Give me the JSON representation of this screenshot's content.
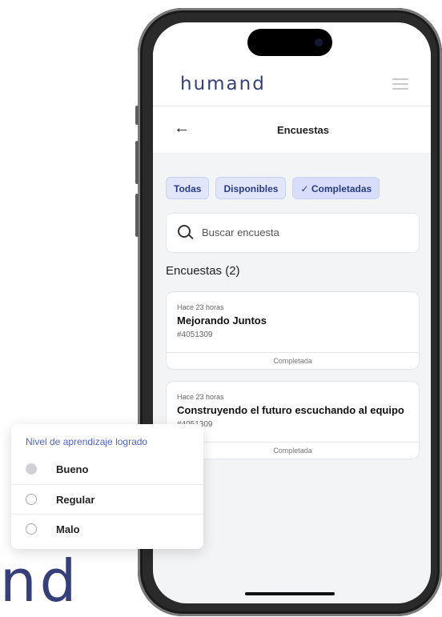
{
  "brand": "humand",
  "navbar": {
    "title": "Encuestas"
  },
  "chips": [
    {
      "label": "Todas"
    },
    {
      "label": "Disponibles"
    },
    {
      "label": "✓ Completadas"
    }
  ],
  "search": {
    "placeholder": "Buscar encuesta"
  },
  "section_title": "Encuestas (2)",
  "surveys": [
    {
      "time": "Hace 23 horas",
      "title": "Mejorando Juntos",
      "id": "#4051309",
      "status": "Completada"
    },
    {
      "time": "Hace 23 horas",
      "title": "Construyendo el futuro escuchando al equipo",
      "id": "#4051309",
      "status": "Completada"
    }
  ],
  "panel": {
    "title": "Nivel de aprendizaje logrado",
    "options": [
      {
        "label": "Bueno"
      },
      {
        "label": "Regular"
      },
      {
        "label": "Malo"
      }
    ]
  },
  "bigtext": "nd",
  "colors": {
    "brand": "#35407a",
    "chip_bg": "#e1e6fb",
    "panel_title": "#4d63d6"
  }
}
